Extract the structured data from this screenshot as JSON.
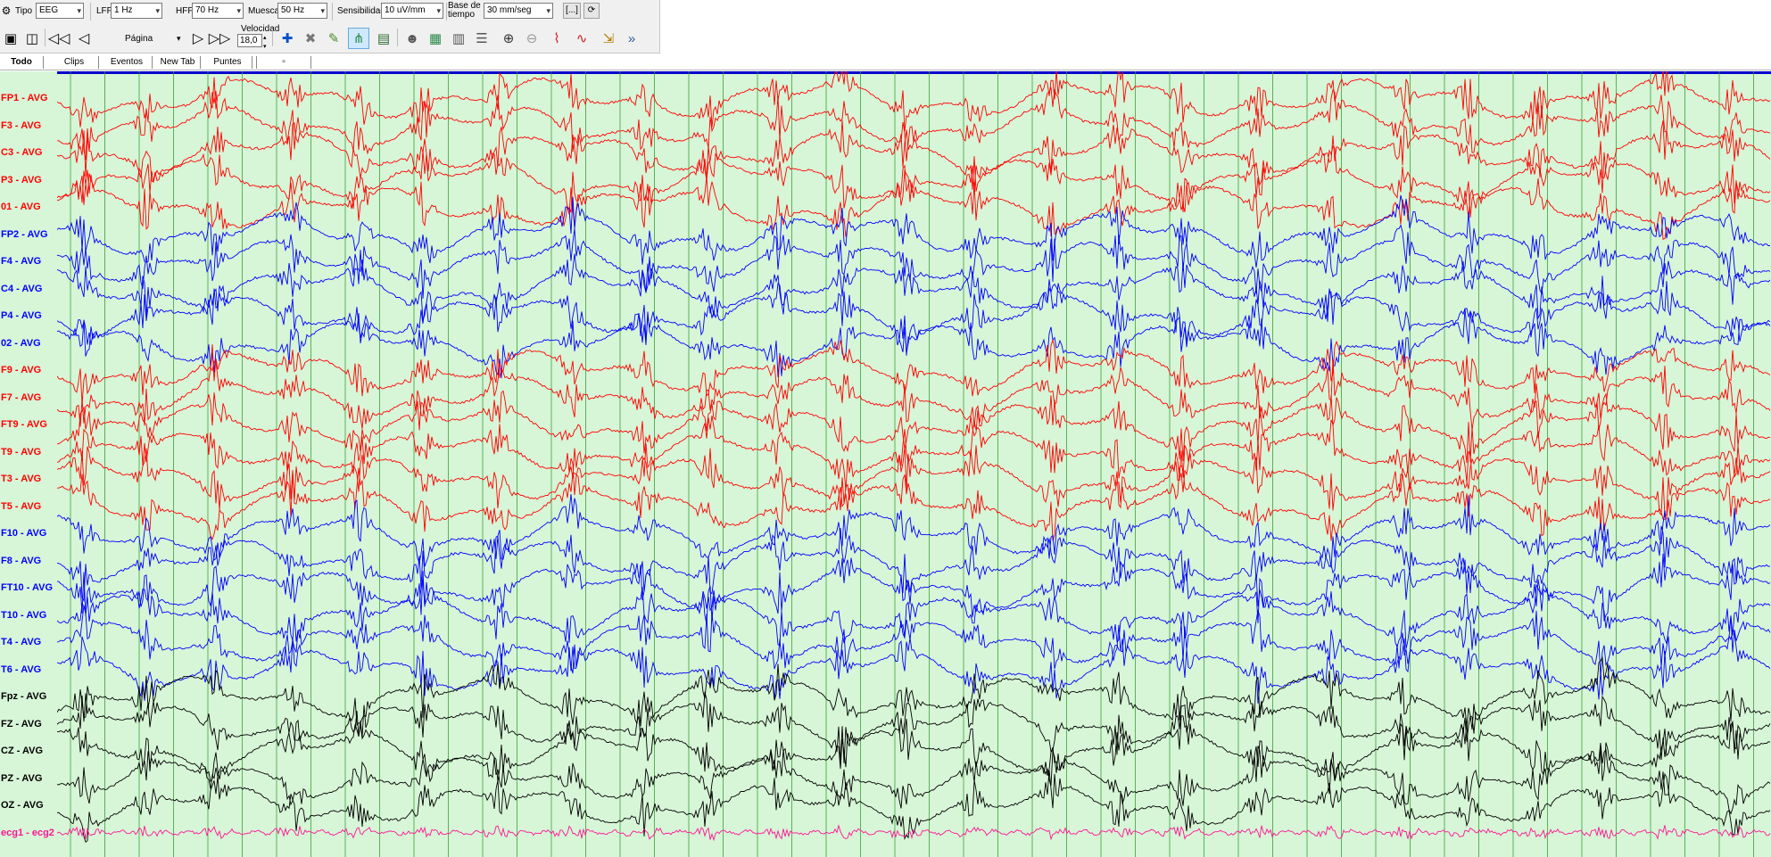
{
  "toolbar": {
    "tipo_label": "Tipo",
    "tipo_value": "EEG",
    "lff_label": "LFF",
    "lff_value": "1 Hz",
    "hff_label": "HFF",
    "hff_value": "70 Hz",
    "muesca_label": "Muesca",
    "muesca_value": "50 Hz",
    "sensibilidad_label": "Sensibilidad",
    "sensibilidad_value": "10 uV/mm",
    "base_label_1": "Base de",
    "base_label_2": "tiempo",
    "base_value": "30 mm/seg",
    "bracket_button": "[...]",
    "pagina_label": "Página",
    "velocidad_label": "Velocidad",
    "velocidad_value": "18,0"
  },
  "tabs": [
    "Todo",
    "Clips",
    "Eventos",
    "New Tab",
    "Puntes"
  ],
  "channels": [
    {
      "label": "FP1 - AVG",
      "color": "#ff0000"
    },
    {
      "label": "F3 - AVG",
      "color": "#ff0000"
    },
    {
      "label": "C3 - AVG",
      "color": "#ff0000"
    },
    {
      "label": "P3 - AVG",
      "color": "#ff0000"
    },
    {
      "label": "01 - AVG",
      "color": "#ff0000"
    },
    {
      "label": "FP2 - AVG",
      "color": "#0000ff"
    },
    {
      "label": "F4 - AVG",
      "color": "#0000ff"
    },
    {
      "label": "C4 - AVG",
      "color": "#0000ff"
    },
    {
      "label": "P4 - AVG",
      "color": "#0000ff"
    },
    {
      "label": "02 - AVG",
      "color": "#0000ff"
    },
    {
      "label": "F9 - AVG",
      "color": "#ff0000"
    },
    {
      "label": "F7 - AVG",
      "color": "#ff0000"
    },
    {
      "label": "FT9 - AVG",
      "color": "#ff0000"
    },
    {
      "label": "T9 - AVG",
      "color": "#ff0000"
    },
    {
      "label": "T3 - AVG",
      "color": "#ff0000"
    },
    {
      "label": "T5 - AVG",
      "color": "#ff0000"
    },
    {
      "label": "F10 - AVG",
      "color": "#0000ff"
    },
    {
      "label": "F8 - AVG",
      "color": "#0000ff"
    },
    {
      "label": "FT10 - AVG",
      "color": "#0000ff"
    },
    {
      "label": "T10 - AVG",
      "color": "#0000ff"
    },
    {
      "label": "T4 - AVG",
      "color": "#0000ff"
    },
    {
      "label": "T6 - AVG",
      "color": "#0000ff"
    },
    {
      "label": "Fpz - AVG",
      "color": "#000000"
    },
    {
      "label": "FZ - AVG",
      "color": "#000000"
    },
    {
      "label": "CZ - AVG",
      "color": "#000000"
    },
    {
      "label": "PZ - AVG",
      "color": "#000000"
    },
    {
      "label": "OZ - AVG",
      "color": "#000000"
    },
    {
      "label": "ecg1 - ecg2",
      "color": "#ff1493"
    }
  ],
  "colors": {
    "background": "#d7f5d7",
    "left_hemisphere": "#ff0000",
    "right_hemisphere": "#0000ff",
    "midline": "#000000",
    "ecg": "#ff1493",
    "gridline": "#2e9e2e",
    "top_border": "#0000cc"
  },
  "icons": {
    "row1": [
      "montage-icon"
    ],
    "row2": [
      "camera-icon",
      "video-icon",
      "first-page-icon",
      "prev-page-icon",
      "next-page-icon",
      "last-page-icon",
      "marker-add-icon",
      "marker-remove-icon",
      "channel-edit-icon",
      "montage-view-icon",
      "layout-icon",
      "patient-icon",
      "report-icon",
      "record-icon",
      "list-icon",
      "zoom-in-icon",
      "zoom-out-icon",
      "spike-icon",
      "wave-icon",
      "export-icon",
      "more-icon"
    ]
  }
}
